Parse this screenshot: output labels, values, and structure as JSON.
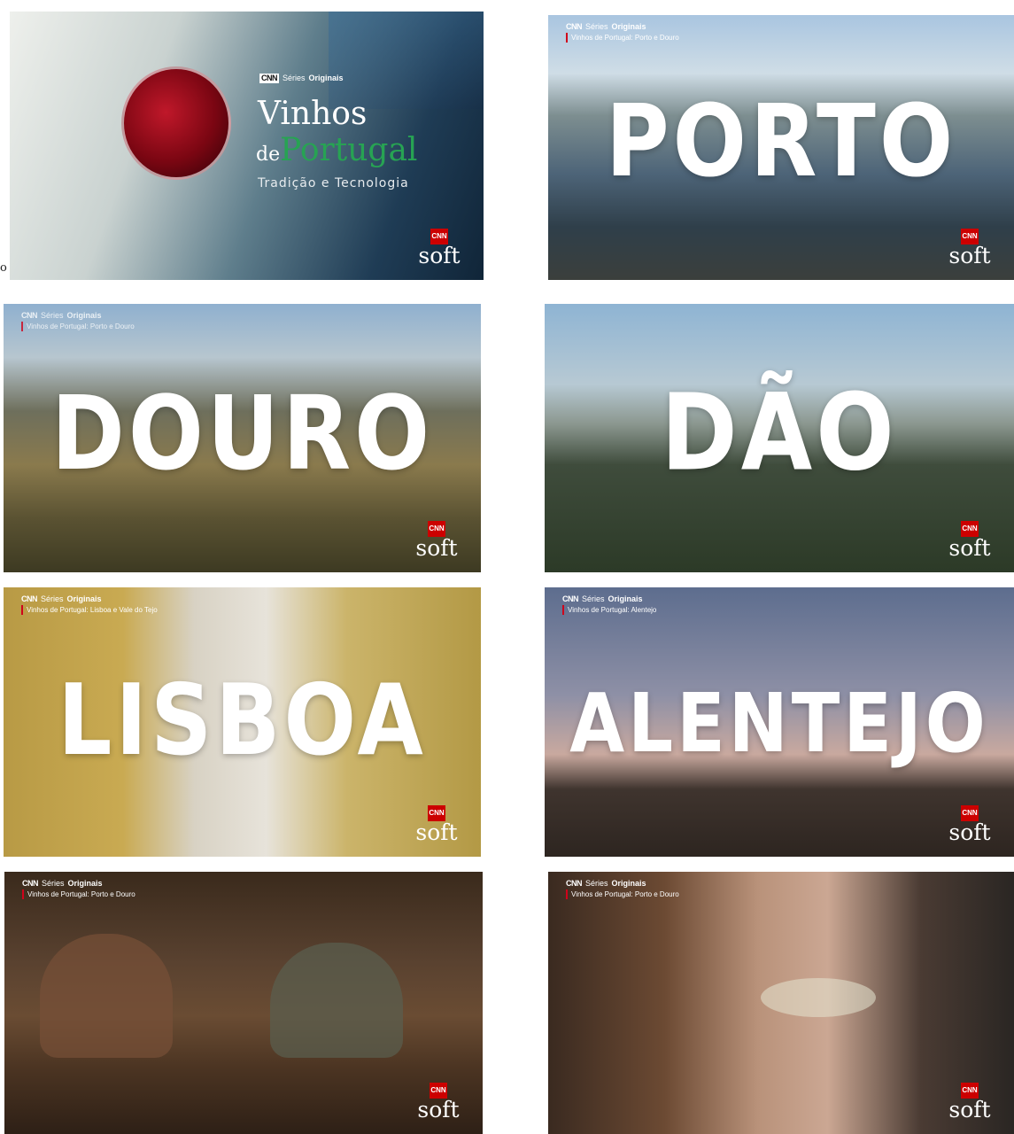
{
  "stray_char": "o",
  "tiles": [
    {
      "cnn": "CNN",
      "series": "Séries",
      "originals": "Originais",
      "sub": "",
      "big": "",
      "soft": "soft"
    },
    {
      "cnn": "CNN",
      "series": "Séries",
      "originals": "Originais",
      "sub": "Vinhos de Portugal: Porto e Douro",
      "big": "PORTO",
      "soft": "soft"
    },
    {
      "cnn": "CNN",
      "series": "Séries",
      "originals": "Originais",
      "sub": "Vinhos de Portugal: Porto e Douro",
      "big": "DOURO",
      "soft": "soft"
    },
    {
      "cnn": "",
      "series": "",
      "originals": "",
      "sub": "",
      "big": "DÃO",
      "soft": "soft"
    },
    {
      "cnn": "CNN",
      "series": "Séries",
      "originals": "Originais",
      "sub": "Vinhos de Portugal: Lisboa e Vale do Tejo",
      "big": "LISBOA",
      "soft": "soft"
    },
    {
      "cnn": "CNN",
      "series": "Séries",
      "originals": "Originais",
      "sub": "Vinhos de Portugal: Alentejo",
      "big": "ALENTEJO",
      "soft": "soft"
    },
    {
      "cnn": "CNN",
      "series": "Séries",
      "originals": "Originais",
      "sub": "Vinhos de Portugal: Porto e Douro",
      "big": "",
      "soft": "soft"
    },
    {
      "cnn": "CNN",
      "series": "Séries",
      "originals": "Originais",
      "sub": "Vinhos de Portugal: Porto e Douro",
      "big": "",
      "soft": "soft"
    }
  ],
  "title": {
    "line1": "Vinhos",
    "de": "de",
    "portugal": "Portugal",
    "tagline": "Tradição e Tecnologia"
  }
}
